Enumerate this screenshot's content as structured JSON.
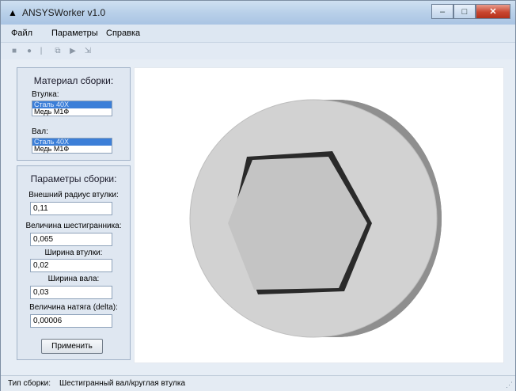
{
  "window": {
    "title": "ANSYSWorker v1.0",
    "minimize_icon": "minimize-icon",
    "maximize_icon": "maximize-icon",
    "close_icon": "close-icon"
  },
  "menu": {
    "items": [
      "Файл",
      "Параметры",
      "Справка"
    ]
  },
  "toolbar": {
    "icons": [
      "square-icon",
      "circle-icon",
      "copy-icon",
      "play-icon",
      "export-icon"
    ]
  },
  "material": {
    "title": "Материал сборки:",
    "bushing_label": "Втулка:",
    "bushing_options": [
      "Сталь 40Х",
      "Медь М1Ф"
    ],
    "bushing_selected": "Сталь 40Х",
    "shaft_label": "Вал:",
    "shaft_options": [
      "Сталь 40Х",
      "Медь М1Ф"
    ],
    "shaft_selected": "Сталь 40Х"
  },
  "params": {
    "title": "Параметры сборки:",
    "outer_radius_label": "Внешний радиус втулки:",
    "outer_radius_value": "0,11",
    "hex_size_label": "Величина шестигранника:",
    "hex_size_value": "0,065",
    "bushing_width_label": "Ширина втулки:",
    "bushing_width_value": "0,02",
    "shaft_width_label": "Ширина вала:",
    "shaft_width_value": "0,03",
    "interference_label": "Величина натяга (delta):",
    "interference_value": "0,00006",
    "apply_label": "Применить"
  },
  "status": {
    "label": "Тип сборки:",
    "value": "Шестигранный вал/круглая втулка"
  },
  "colors": {
    "titlebar": "#b9d0e9",
    "selection": "#3c7fd8",
    "model_face": "#d2d2d2",
    "model_side": "#8f8f8f"
  }
}
